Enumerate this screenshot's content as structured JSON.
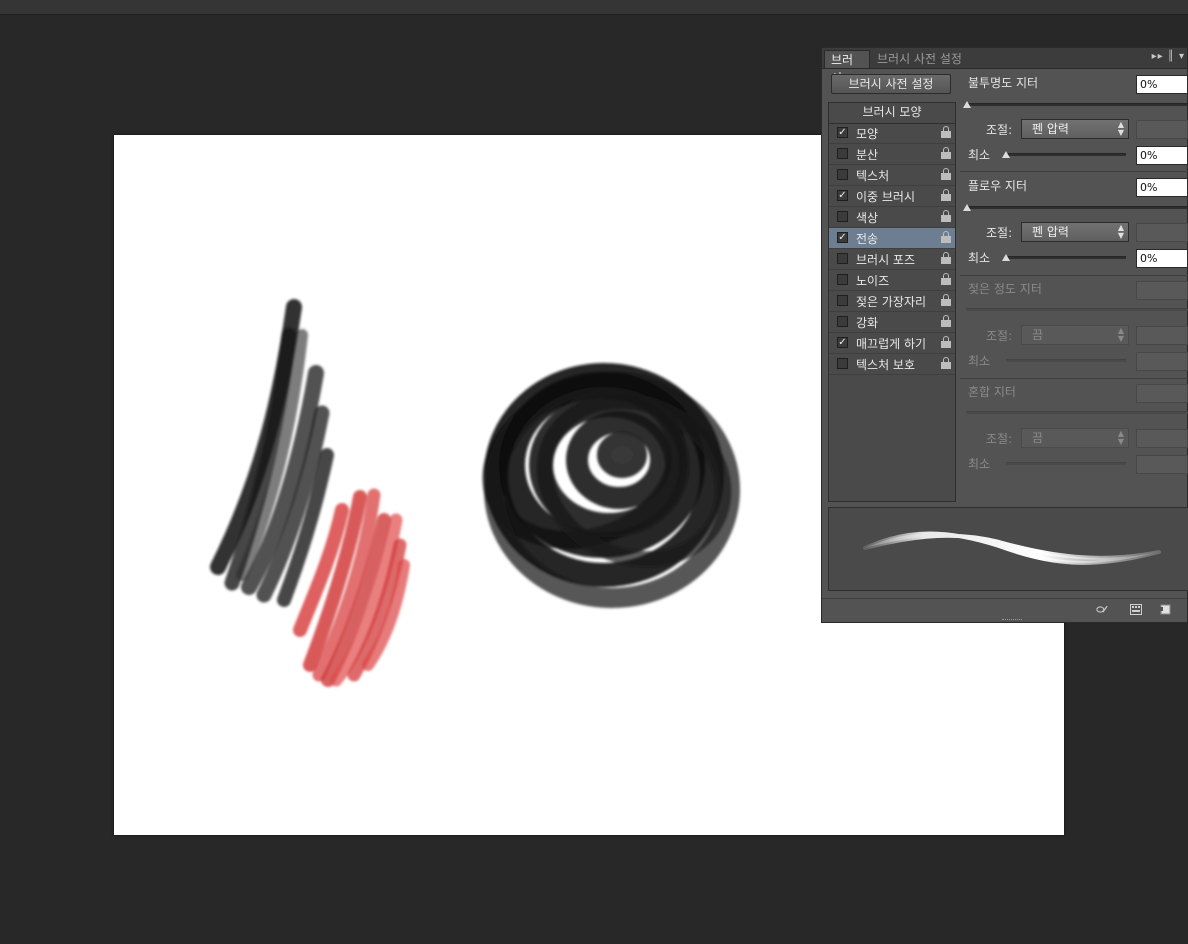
{
  "panel": {
    "tabs": [
      "브러시",
      "브러시 사전 설정"
    ],
    "preset_button": "브러시 사전 설정",
    "shape_header": "브러시 모양",
    "options": [
      {
        "label": "모양",
        "checked": true,
        "selected": false
      },
      {
        "label": "분산",
        "checked": false,
        "selected": false
      },
      {
        "label": "텍스처",
        "checked": false,
        "selected": false
      },
      {
        "label": "이중 브러시",
        "checked": true,
        "selected": false
      },
      {
        "label": "색상",
        "checked": false,
        "selected": false
      },
      {
        "label": "전송",
        "checked": true,
        "selected": true
      },
      {
        "label": "브러시 포즈",
        "checked": false,
        "selected": false
      },
      {
        "label": "노이즈",
        "checked": false,
        "selected": false
      },
      {
        "label": "젖은 가장자리",
        "checked": false,
        "selected": false
      },
      {
        "label": "강화",
        "checked": false,
        "selected": false
      },
      {
        "label": "매끄럽게 하기",
        "checked": true,
        "selected": false
      },
      {
        "label": "텍스처 보호",
        "checked": false,
        "selected": false
      }
    ],
    "opacity": {
      "label": "불투명도 지터",
      "value": "0%",
      "control_label": "조절:",
      "control_value": "펜 압력",
      "min_label": "최소",
      "min_value": "0%"
    },
    "flow": {
      "label": "플로우 지터",
      "value": "0%",
      "control_label": "조절:",
      "control_value": "펜 압력",
      "min_label": "최소",
      "min_value": "0%"
    },
    "wetness": {
      "label": "젖은 정도 지터",
      "control_label": "조절:",
      "control_value": "끔",
      "min_label": "최소"
    },
    "mix": {
      "label": "혼합 지터",
      "control_label": "조절:",
      "control_value": "끔",
      "min_label": "최소"
    }
  },
  "colors": {
    "canvas_bg": "#282828",
    "panel_bg": "#535353",
    "selected_row": "#6d7d92",
    "stroke_black": "#111111",
    "stroke_red": "#d63a3a"
  }
}
